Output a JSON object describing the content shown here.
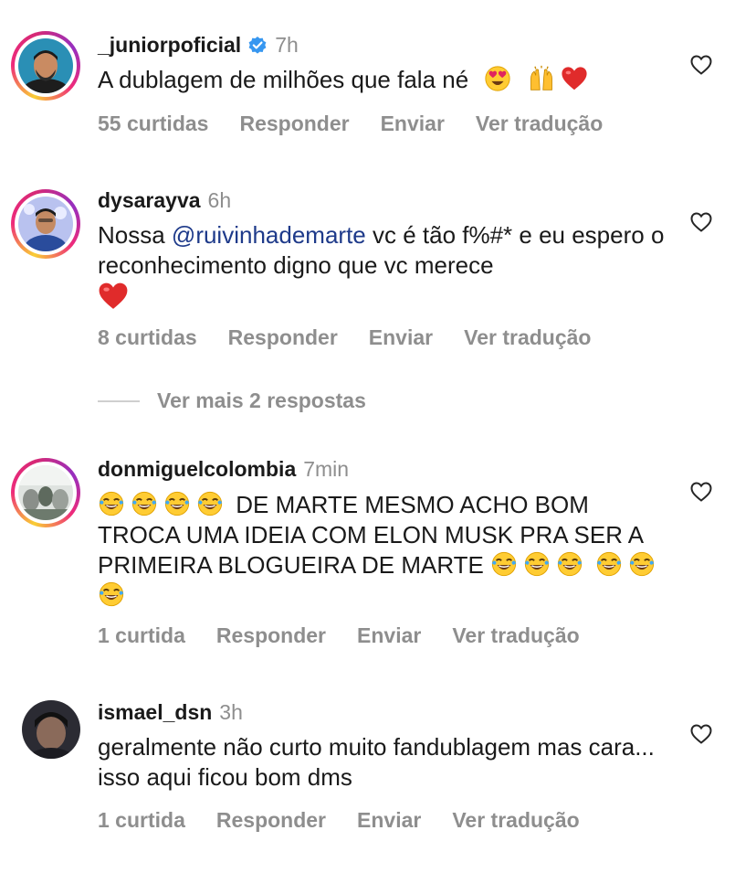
{
  "comments": [
    {
      "username": "_juniorpoficial",
      "verified": true,
      "time": "7h",
      "text": "A dublagem de milhões que fala né",
      "emojis_after": [
        "heart-eyes-emoji",
        "raising-hands-emoji",
        "red-heart-emoji"
      ],
      "likes": "55 curtidas",
      "reply": "Responder",
      "send": "Enviar",
      "translate": "Ver tradução"
    },
    {
      "username": "dysarayva",
      "time": "6h",
      "text_prefix": "Nossa ",
      "mention": "@ruivinhademarte",
      "text_suffix": " vc é tão f%#* e eu espero o reconhecimento digno que vc merece",
      "emojis_after": [
        "red-heart-emoji"
      ],
      "likes": "8 curtidas",
      "reply": "Responder",
      "send": "Enviar",
      "translate": "Ver tradução"
    },
    {
      "username": "donmiguelcolombia",
      "time": "7min",
      "text": "DE MARTE MESMO ACHO BOM TROCA UMA IDEIA COM ELON MUSK PRA SER A PRIMEIRA BLOGUEIRA DE MARTE",
      "emojis_before": [
        "tears-of-joy-emoji",
        "tears-of-joy-emoji",
        "tears-of-joy-emoji",
        "tears-of-joy-emoji"
      ],
      "emojis_after": [
        "tears-of-joy-emoji",
        "tears-of-joy-emoji",
        "tears-of-joy-emoji",
        "tears-of-joy-emoji",
        "tears-of-joy-emoji",
        "tears-of-joy-emoji"
      ],
      "likes": "1 curtida",
      "reply": "Responder",
      "send": "Enviar",
      "translate": "Ver tradução"
    },
    {
      "username": "ismael_dsn",
      "time": "3h",
      "text": "geralmente não curto muito fandublagem mas cara... isso aqui ficou bom dms",
      "likes": "1 curtida",
      "reply": "Responder",
      "send": "Enviar",
      "translate": "Ver tradução"
    }
  ],
  "more_replies": "Ver mais 2 respostas",
  "colors": {
    "text": "#1a1a1a",
    "muted": "#8e8e8e",
    "mention": "#1e3a8a",
    "verified": "#3797f0",
    "story_ring": "#ee2a7b"
  }
}
